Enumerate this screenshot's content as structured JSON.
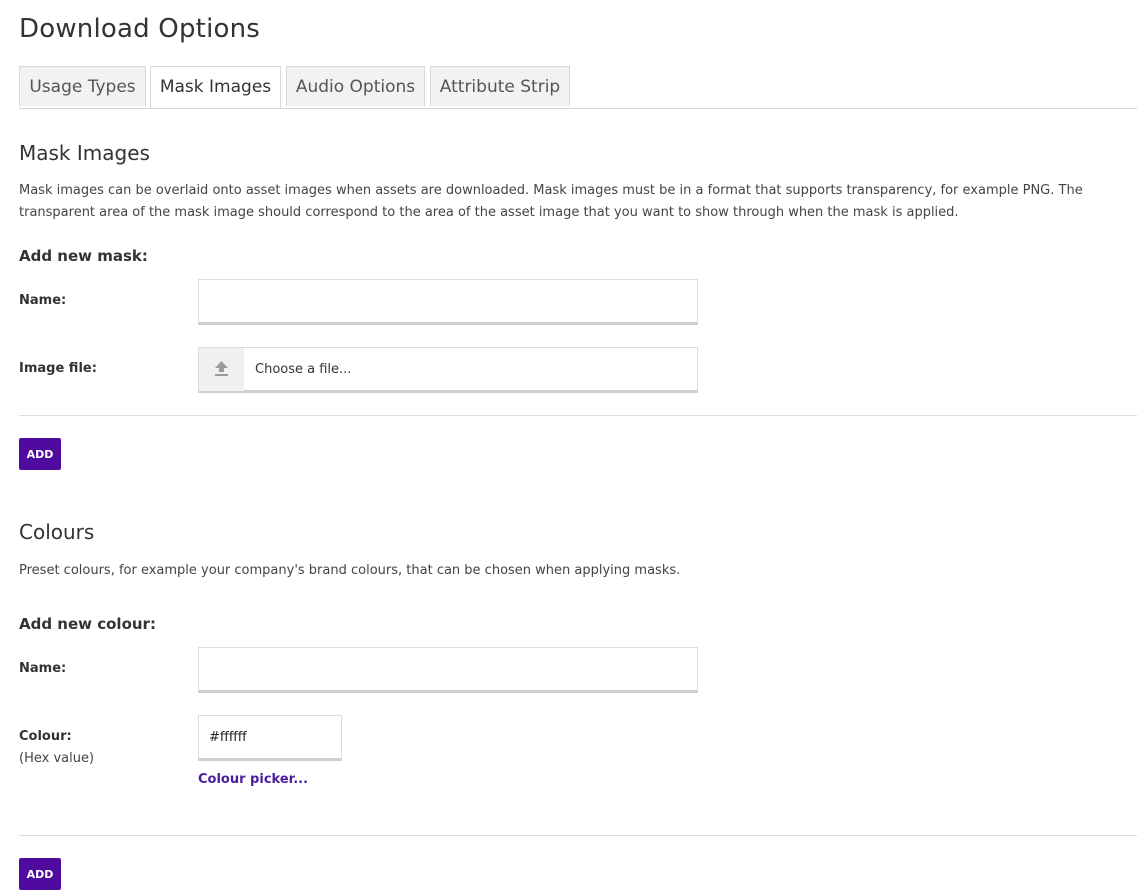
{
  "page_title": "Download Options",
  "tabs": [
    {
      "label": "Usage Types",
      "active": false
    },
    {
      "label": "Mask Images",
      "active": true
    },
    {
      "label": "Audio Options",
      "active": false
    },
    {
      "label": "Attribute Strip",
      "active": false
    }
  ],
  "mask_section": {
    "title": "Mask Images",
    "description": "Mask images can be overlaid onto asset images when assets are downloaded. Mask images must be in a format that supports transparency, for example PNG. The transparent area of the mask image should correspond to the area of the asset image that you want to show through when the mask is applied.",
    "add_heading": "Add new mask:",
    "name_label": "Name:",
    "name_value": "",
    "image_file_label": "Image file:",
    "file_placeholder": "Choose a file...",
    "upload_icon": "upload-icon",
    "add_button": "ADD"
  },
  "colour_section": {
    "title": "Colours",
    "description": "Preset colours, for example your company's brand colours, that can be chosen when applying masks.",
    "add_heading": "Add new colour:",
    "name_label": "Name:",
    "name_value": "",
    "colour_label": "Colour:",
    "colour_sublabel": "(Hex value)",
    "hex_value": "#ffffff",
    "picker_link": "Colour picker...",
    "add_button": "ADD"
  },
  "colors": {
    "accent": "#4f0a9e",
    "link": "#4b1d9e"
  }
}
